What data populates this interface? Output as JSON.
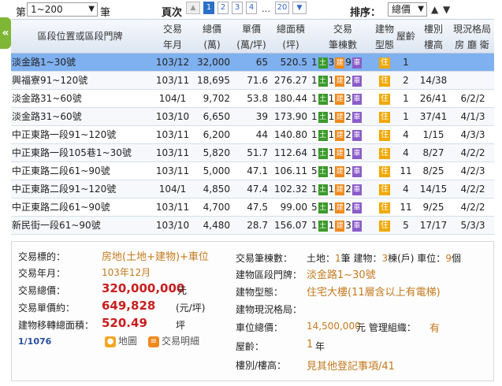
{
  "toolbar": {
    "prefix": "第",
    "range": "1~200",
    "suffix": "筆",
    "pages_label": "頁次",
    "pages": [
      "1",
      "2",
      "3",
      "4",
      "…",
      "20"
    ],
    "current_page": "1",
    "sort_label": "排序：",
    "sort_value": "總價"
  },
  "headers": {
    "addr": "區段位置或區段門牌",
    "ym": "交易\n年月",
    "tot": "總價\n(萬)",
    "up": "單價\n(萬/坪)",
    "area": "總面積\n(坪)",
    "tx": "交易\n筆棟數",
    "bt": "建物\n型態",
    "fl": "屋齡",
    "fh": "樓別\n樓高",
    "lay": "現況格局\n房 廳 衛"
  },
  "rows": [
    {
      "addr": "淡金路1~30號",
      "ym": "103/12",
      "tot": "32,000",
      "up": "65",
      "area": "520.5",
      "land": "1",
      "bld": "3",
      "car": "9",
      "bt": "住",
      "fl": "1",
      "fh": "",
      "lay": ""
    },
    {
      "addr": "興福寮91~120號",
      "ym": "103/11",
      "tot": "18,695",
      "up": "71.6",
      "area": "276.27",
      "land": "1",
      "bld": "1",
      "car": "2",
      "bt": "住",
      "fl": "2",
      "fh": "14/38",
      "lay": ""
    },
    {
      "addr": "淡金路31~60號",
      "ym": "104/1",
      "tot": "9,702",
      "up": "53.8",
      "area": "180.44",
      "land": "1",
      "bld": "1",
      "car": "3",
      "bt": "住",
      "fl": "1",
      "fh": "26/41",
      "lay": "6/2/2"
    },
    {
      "addr": "淡金路31~60號",
      "ym": "103/10",
      "tot": "6,650",
      "up": "39",
      "area": "173.90",
      "land": "1",
      "bld": "1",
      "car": "2",
      "bt": "住",
      "fl": "1",
      "fh": "37/41",
      "lay": "4/1/3"
    },
    {
      "addr": "中正東路一段91~120號",
      "ym": "103/11",
      "tot": "6,200",
      "up": "44",
      "area": "140.80",
      "land": "1",
      "bld": "1",
      "car": "2",
      "bt": "住",
      "fl": "4",
      "fh": "1/15",
      "lay": "4/3/3"
    },
    {
      "addr": "中正東路一段105巷1~30號",
      "ym": "103/11",
      "tot": "5,820",
      "up": "51.7",
      "area": "112.64",
      "land": "1",
      "bld": "1",
      "car": "1",
      "bt": "住",
      "fl": "4",
      "fh": "8/27",
      "lay": "4/2/2"
    },
    {
      "addr": "中正東路二段61~90號",
      "ym": "103/11",
      "tot": "5,000",
      "up": "47.1",
      "area": "106.11",
      "land": "5",
      "bld": "1",
      "car": "2",
      "bt": "住",
      "fl": "11",
      "fh": "8/25",
      "lay": "4/2/3"
    },
    {
      "addr": "中正東路二段91~120號",
      "ym": "104/1",
      "tot": "4,850",
      "up": "47.4",
      "area": "102.32",
      "land": "1",
      "bld": "1",
      "car": "2",
      "bt": "住",
      "fl": "4",
      "fh": "14/15",
      "lay": "4/2/2"
    },
    {
      "addr": "中正東路二段61~90號",
      "ym": "103/11",
      "tot": "4,700",
      "up": "47.5",
      "area": "99.00",
      "land": "5",
      "bld": "1",
      "car": "2",
      "bt": "住",
      "fl": "11",
      "fh": "9/25",
      "lay": "4/2/2"
    },
    {
      "addr": "新民街一段61~90號",
      "ym": "103/10",
      "tot": "4,480",
      "up": "28.7",
      "area": "156.07",
      "land": "1",
      "bld": "1",
      "car": "3",
      "bt": "住",
      "fl": "5",
      "fh": "17/17",
      "lay": "5/3/3"
    }
  ],
  "tags": {
    "land": "土",
    "bld": "建",
    "car": "車"
  },
  "detail": {
    "l_target": "交易標的：",
    "v_target": "房地(土地+建物)+車位",
    "l_ym": "交易年月：",
    "v_ym": "103年12月",
    "l_tot": "交易總價：",
    "v_tot": "320,000,000",
    "u_tot": "元",
    "l_up": "交易單價約：",
    "v_up": "649,828",
    "u_up": "(元/坪)",
    "l_area": "建物移轉總面積：",
    "v_area": "520.49",
    "u_area": "坪",
    "counter": "1/1076",
    "btn_map": "地圖",
    "btn_detail": "交易明細",
    "l_cnt": "交易筆棟數：",
    "v_cnt_land": "土地：",
    "n_land": "1",
    "v_cnt_land2": "筆 建物：",
    "n_bld": "3",
    "v_cnt_bld2": "棟(戶) 車位：",
    "n_car": "9",
    "v_cnt_car2": "個",
    "l_loc": "建物區段門牌：",
    "v_loc": "淡金路1~30號",
    "l_type": "建物型態：",
    "v_type": "住宅大樓(11層含以上有電梯)",
    "l_layout": "建物現況格局：",
    "l_car": "車位總價：",
    "v_car": "14,500,000",
    "u_car": "元 管理組織：",
    "v_mgmt": "有",
    "l_age": "屋齡：",
    "v_age": "1",
    "u_age": "年",
    "l_floor": "樓別/樓高：",
    "v_floor": "見其他登記事項/41"
  }
}
